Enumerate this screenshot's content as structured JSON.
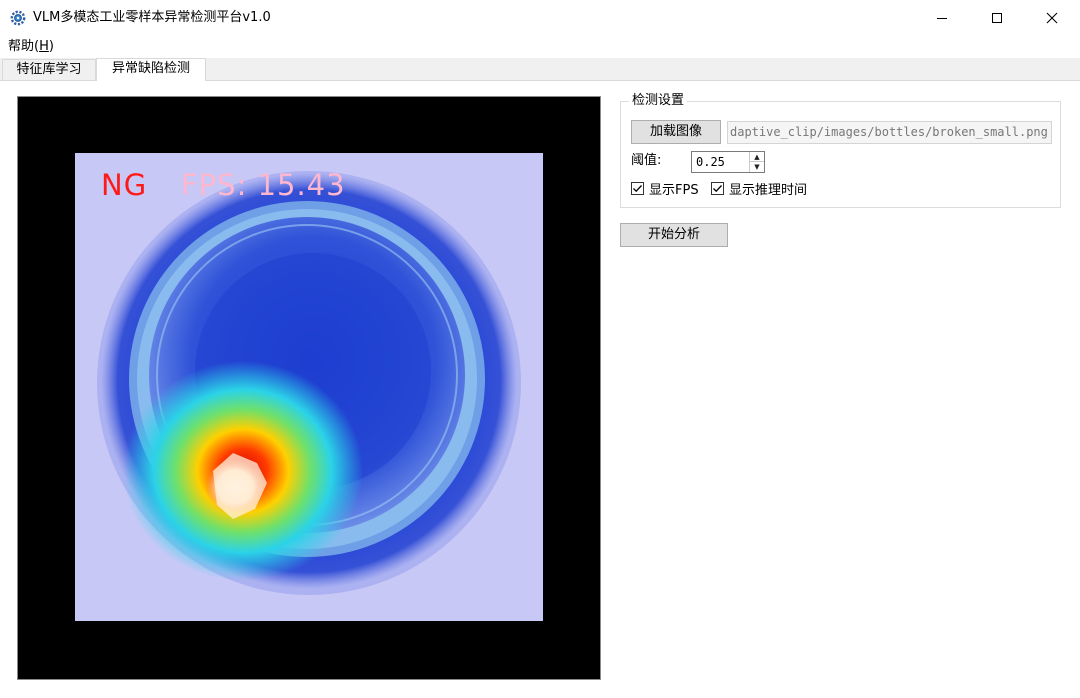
{
  "window": {
    "title": "VLM多模态工业零样本异常检测平台v1.0",
    "icon": "gear-icon"
  },
  "menu": {
    "help_label": "帮助(",
    "help_mnemonic": "H",
    "help_close": ")"
  },
  "tabs": [
    {
      "label": "特征库学习",
      "active": false
    },
    {
      "label": "异常缺陷检测",
      "active": true
    }
  ],
  "viewer": {
    "status_text": "NG",
    "fps_text": "FPS: 15.43",
    "status_color": "#ff1a1a"
  },
  "settings": {
    "group_title": "检测设置",
    "load_button": "加载图像",
    "image_path": "daptive_clip/images/bottles/broken_small.png",
    "threshold_label": "阈值:",
    "threshold_value": "0.25",
    "show_fps_label": "显示FPS",
    "show_fps_checked": true,
    "show_time_label": "显示推理时间",
    "show_time_checked": true
  },
  "actions": {
    "start_button": "开始分析"
  }
}
